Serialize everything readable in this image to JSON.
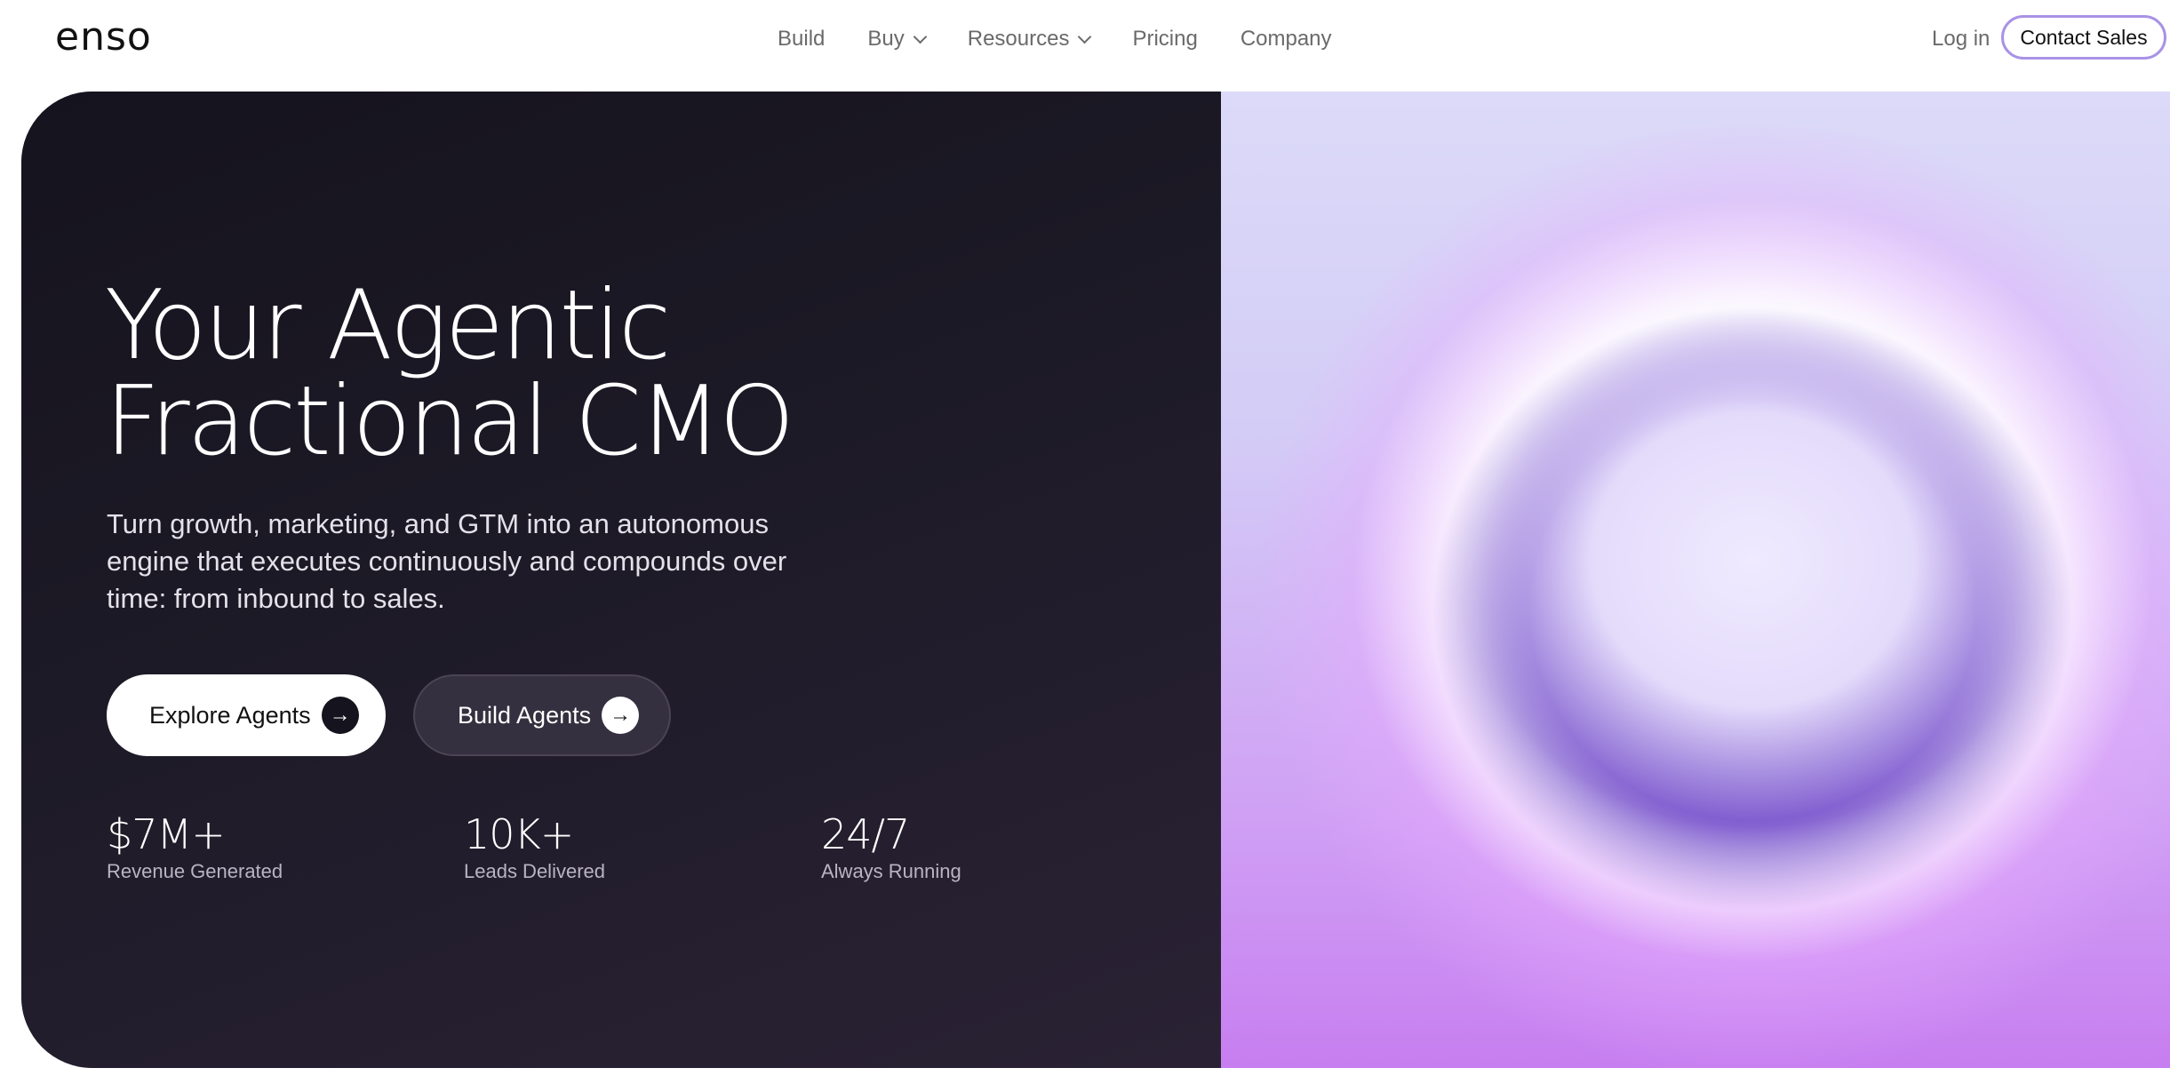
{
  "nav": {
    "logo": "enso",
    "links": [
      {
        "label": "Build",
        "dropdown": false
      },
      {
        "label": "Buy",
        "dropdown": true
      },
      {
        "label": "Resources",
        "dropdown": true
      },
      {
        "label": "Pricing",
        "dropdown": false
      },
      {
        "label": "Company",
        "dropdown": false
      }
    ],
    "login": "Log in",
    "contact": "Contact Sales"
  },
  "hero": {
    "headline_line1": "Your Agentic",
    "headline_line2": "Fractional CMO",
    "subtitle": "Turn growth, marketing, and GTM into an autonomous engine that executes continuously and compounds over time: from inbound to sales.",
    "primary_button": "Explore Agents",
    "secondary_button": "Build Agents",
    "arrow_icon": "→",
    "stats": [
      {
        "value": "$7M+",
        "label": "Revenue Generated"
      },
      {
        "value": "10K+",
        "label": "Leads Delivered"
      },
      {
        "value": "24/7",
        "label": "Always Running"
      }
    ]
  },
  "colors": {
    "hero_dark": "#1c1825",
    "accent_purple": "#a992e6",
    "orb_purple": "#5a34b8"
  }
}
